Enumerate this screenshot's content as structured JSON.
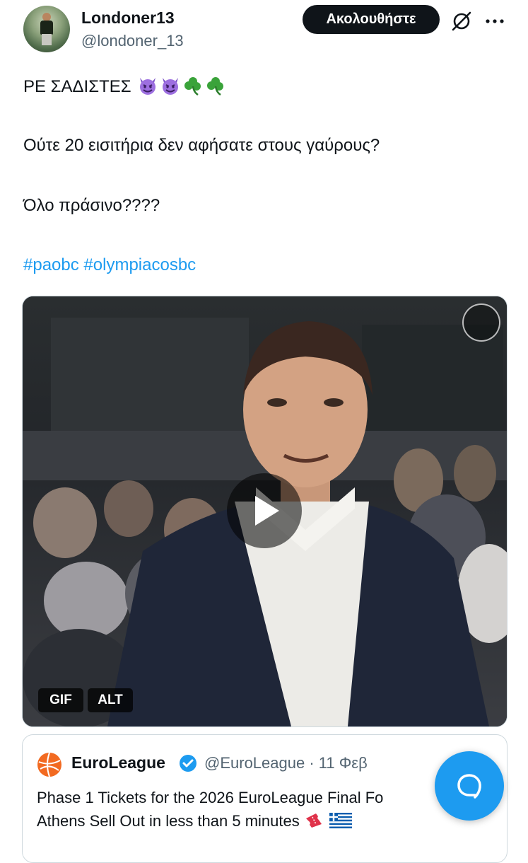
{
  "author": {
    "display_name": "Londoner13",
    "handle": "@londoner_13"
  },
  "actions": {
    "follow_label": "Ακολουθήστε",
    "grok_icon": "grok-icon",
    "more_icon": "more-icon"
  },
  "post": {
    "line1_text": "ΡΕ ΣΑΔΙΣΤΕΣ",
    "line1_emojis": [
      "smiling-imp",
      "smiling-imp",
      "shamrock",
      "shamrock"
    ],
    "line2": "Ούτε 20 εισιτήρια δεν αφήσατε στους γαύρους?",
    "line3": "Όλο πράσινο????",
    "hashtags": [
      "#paobc",
      "#olympiacosbc"
    ]
  },
  "media": {
    "type_badge": "GIF",
    "alt_badge": "ALT",
    "play_icon": "play-icon"
  },
  "quote": {
    "name": "EuroLeague",
    "handle_date": "@EuroLeague · 11 Φεβ",
    "line1": "Phase 1 Tickets for the 2026 EuroLeague Final Fo",
    "line2": "Athens Sell Out in less than 5 minutes"
  },
  "colors": {
    "accent": "#1d9bf0",
    "text": "#0f1419",
    "muted": "#536471",
    "border": "#cfd9de"
  }
}
